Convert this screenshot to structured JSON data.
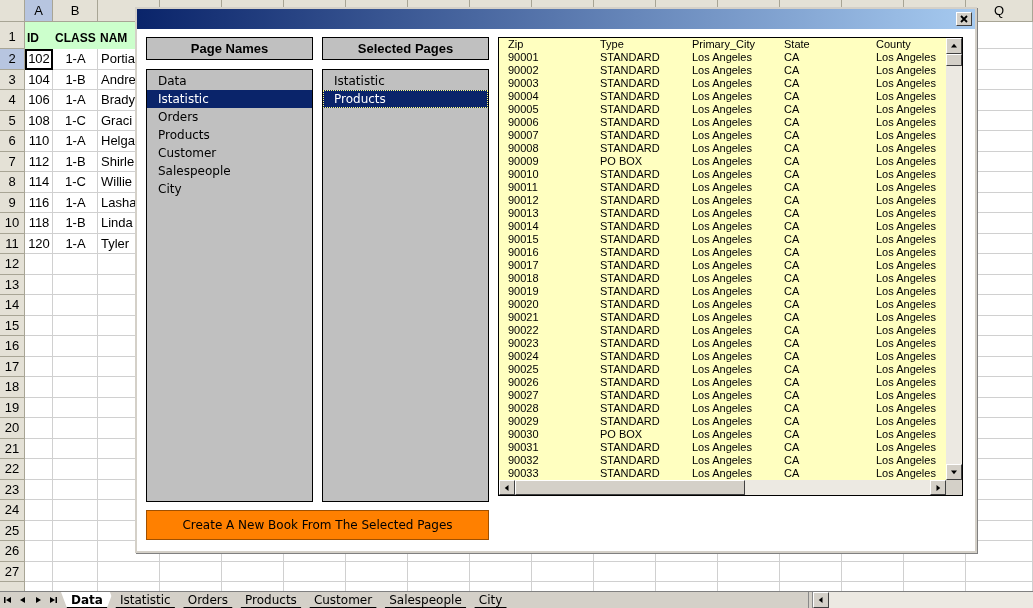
{
  "sheet": {
    "columns": [
      "A",
      "B"
    ],
    "far_column": "Q",
    "header_row_number": "1",
    "header_row": [
      "ID",
      "CLASS",
      "NAM"
    ],
    "rows": [
      {
        "number": "2",
        "cells": [
          "102",
          "1-A",
          "Portia"
        ],
        "selected": true
      },
      {
        "number": "3",
        "cells": [
          "104",
          "1-B",
          "Andre"
        ],
        "selected": false
      },
      {
        "number": "4",
        "cells": [
          "106",
          "1-A",
          "Brady"
        ],
        "selected": false
      },
      {
        "number": "5",
        "cells": [
          "108",
          "1-C",
          "Graci"
        ],
        "selected": false
      },
      {
        "number": "6",
        "cells": [
          "110",
          "1-A",
          "Helga"
        ],
        "selected": false
      },
      {
        "number": "7",
        "cells": [
          "112",
          "1-B",
          "Shirle"
        ],
        "selected": false
      },
      {
        "number": "8",
        "cells": [
          "114",
          "1-C",
          "Willie"
        ],
        "selected": false
      },
      {
        "number": "9",
        "cells": [
          "116",
          "1-A",
          "Lasha"
        ],
        "selected": false
      },
      {
        "number": "10",
        "cells": [
          "118",
          "1-B",
          "Linda"
        ],
        "selected": false
      },
      {
        "number": "11",
        "cells": [
          "120",
          "1-A",
          "Tyler"
        ],
        "selected": false
      }
    ],
    "empty_row_numbers": [
      "12",
      "13",
      "14",
      "15",
      "16",
      "17",
      "18",
      "19",
      "20",
      "21",
      "22",
      "23",
      "24",
      "25",
      "26",
      "27"
    ],
    "tabs": [
      {
        "label": "Data",
        "selected": true
      },
      {
        "label": "Istatistic",
        "selected": false
      },
      {
        "label": "Orders",
        "selected": false
      },
      {
        "label": "Products",
        "selected": false
      },
      {
        "label": "Customer",
        "selected": false
      },
      {
        "label": "Salespeople",
        "selected": false
      },
      {
        "label": "City",
        "selected": false
      }
    ]
  },
  "dialog": {
    "page_names": {
      "header": "Page Names",
      "items": [
        {
          "label": "Data",
          "selected": false,
          "focused": false
        },
        {
          "label": "Istatistic",
          "selected": true,
          "focused": false
        },
        {
          "label": "Orders",
          "selected": false,
          "focused": false
        },
        {
          "label": "Products",
          "selected": false,
          "focused": false
        },
        {
          "label": "Customer",
          "selected": false,
          "focused": false
        },
        {
          "label": "Salespeople",
          "selected": false,
          "focused": false
        },
        {
          "label": "City",
          "selected": false,
          "focused": false
        }
      ]
    },
    "selected_pages": {
      "header": "Selected Pages",
      "items": [
        {
          "label": "Istatistic",
          "selected": false,
          "focused": false
        },
        {
          "label": "Products",
          "selected": true,
          "focused": true
        }
      ]
    },
    "create_button": "Create A New Book From The Selected Pages",
    "preview": {
      "columns": [
        "Zip",
        "Type",
        "Primary_City",
        "State",
        "County"
      ],
      "rows": [
        [
          "90001",
          "STANDARD",
          "Los Angeles",
          "CA",
          "Los Angeles"
        ],
        [
          "90002",
          "STANDARD",
          "Los Angeles",
          "CA",
          "Los Angeles"
        ],
        [
          "90003",
          "STANDARD",
          "Los Angeles",
          "CA",
          "Los Angeles"
        ],
        [
          "90004",
          "STANDARD",
          "Los Angeles",
          "CA",
          "Los Angeles"
        ],
        [
          "90005",
          "STANDARD",
          "Los Angeles",
          "CA",
          "Los Angeles"
        ],
        [
          "90006",
          "STANDARD",
          "Los Angeles",
          "CA",
          "Los Angeles"
        ],
        [
          "90007",
          "STANDARD",
          "Los Angeles",
          "CA",
          "Los Angeles"
        ],
        [
          "90008",
          "STANDARD",
          "Los Angeles",
          "CA",
          "Los Angeles"
        ],
        [
          "90009",
          "PO BOX",
          "Los Angeles",
          "CA",
          "Los Angeles"
        ],
        [
          "90010",
          "STANDARD",
          "Los Angeles",
          "CA",
          "Los Angeles"
        ],
        [
          "90011",
          "STANDARD",
          "Los Angeles",
          "CA",
          "Los Angeles"
        ],
        [
          "90012",
          "STANDARD",
          "Los Angeles",
          "CA",
          "Los Angeles"
        ],
        [
          "90013",
          "STANDARD",
          "Los Angeles",
          "CA",
          "Los Angeles"
        ],
        [
          "90014",
          "STANDARD",
          "Los Angeles",
          "CA",
          "Los Angeles"
        ],
        [
          "90015",
          "STANDARD",
          "Los Angeles",
          "CA",
          "Los Angeles"
        ],
        [
          "90016",
          "STANDARD",
          "Los Angeles",
          "CA",
          "Los Angeles"
        ],
        [
          "90017",
          "STANDARD",
          "Los Angeles",
          "CA",
          "Los Angeles"
        ],
        [
          "90018",
          "STANDARD",
          "Los Angeles",
          "CA",
          "Los Angeles"
        ],
        [
          "90019",
          "STANDARD",
          "Los Angeles",
          "CA",
          "Los Angeles"
        ],
        [
          "90020",
          "STANDARD",
          "Los Angeles",
          "CA",
          "Los Angeles"
        ],
        [
          "90021",
          "STANDARD",
          "Los Angeles",
          "CA",
          "Los Angeles"
        ],
        [
          "90022",
          "STANDARD",
          "Los Angeles",
          "CA",
          "Los Angeles"
        ],
        [
          "90023",
          "STANDARD",
          "Los Angeles",
          "CA",
          "Los Angeles"
        ],
        [
          "90024",
          "STANDARD",
          "Los Angeles",
          "CA",
          "Los Angeles"
        ],
        [
          "90025",
          "STANDARD",
          "Los Angeles",
          "CA",
          "Los Angeles"
        ],
        [
          "90026",
          "STANDARD",
          "Los Angeles",
          "CA",
          "Los Angeles"
        ],
        [
          "90027",
          "STANDARD",
          "Los Angeles",
          "CA",
          "Los Angeles"
        ],
        [
          "90028",
          "STANDARD",
          "Los Angeles",
          "CA",
          "Los Angeles"
        ],
        [
          "90029",
          "STANDARD",
          "Los Angeles",
          "CA",
          "Los Angeles"
        ],
        [
          "90030",
          "PO BOX",
          "Los Angeles",
          "CA",
          "Los Angeles"
        ],
        [
          "90031",
          "STANDARD",
          "Los Angeles",
          "CA",
          "Los Angeles"
        ],
        [
          "90032",
          "STANDARD",
          "Los Angeles",
          "CA",
          "Los Angeles"
        ],
        [
          "90033",
          "STANDARD",
          "Los Angeles",
          "CA",
          "Los Angeles"
        ]
      ]
    }
  }
}
